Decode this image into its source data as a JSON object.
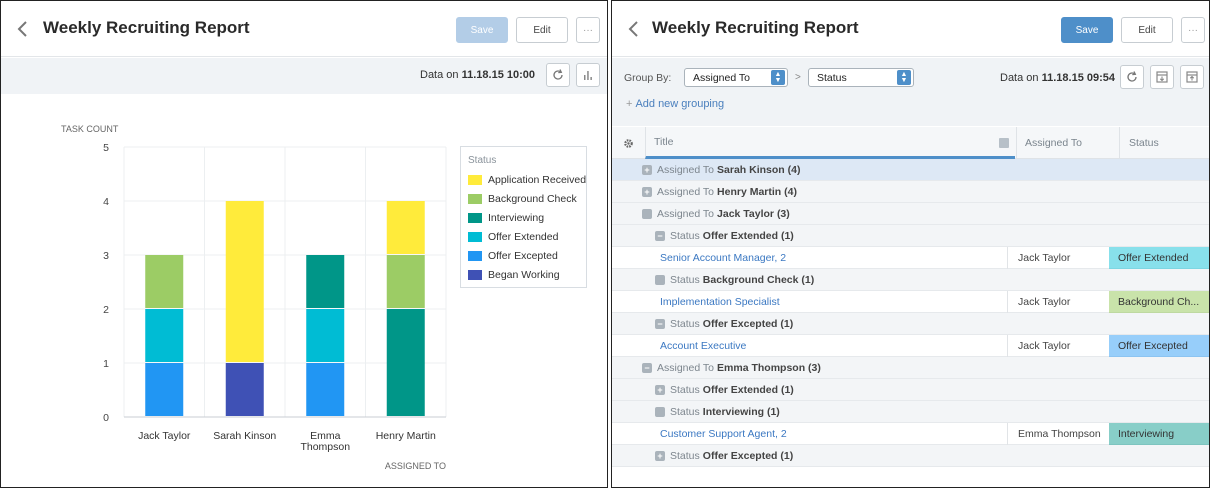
{
  "left": {
    "title": "Weekly Recruiting Report",
    "save_label": "Save",
    "edit_label": "Edit",
    "more_label": "···",
    "data_on_prefix": "Data on",
    "data_on_value": "11.18.15 10:00"
  },
  "right": {
    "title": "Weekly Recruiting Report",
    "save_label": "Save",
    "edit_label": "Edit",
    "more_label": "···",
    "data_on_prefix": "Data on",
    "data_on_value": "11.18.15 09:54",
    "group_by_label": "Group By:",
    "group_by_1": "Assigned To",
    "group_by_separator": ">",
    "group_by_2": "Status",
    "add_grouping": "Add new grouping",
    "columns": {
      "title": "Title",
      "assigned_to": "Assigned To",
      "status": "Status"
    },
    "rows": [
      {
        "kind": "group",
        "icon": "+",
        "prefix": "Assigned To",
        "value": "Sarah Kinson (4)",
        "selected": true
      },
      {
        "kind": "group",
        "icon": "+",
        "prefix": "Assigned To",
        "value": "Henry Martin (4)"
      },
      {
        "kind": "group",
        "icon": "",
        "prefix": "Assigned To",
        "value": "Jack Taylor (3)"
      },
      {
        "kind": "subgroup",
        "icon": "−",
        "prefix": "Status",
        "value": "Offer Extended (1)"
      },
      {
        "kind": "data",
        "title": "Senior Account Manager, 2",
        "assignee": "Jack Taylor",
        "status": "Offer Extended",
        "status_color": "#26c6da"
      },
      {
        "kind": "subgroup",
        "icon": "",
        "prefix": "Status",
        "value": "Background Check (1)"
      },
      {
        "kind": "data",
        "title": "Implementation Specialist",
        "assignee": "Jack Taylor",
        "status": "Background Ch...",
        "status_color": "#9ccc65"
      },
      {
        "kind": "subgroup",
        "icon": "−",
        "prefix": "Status",
        "value": "Offer Excepted (1)"
      },
      {
        "kind": "data",
        "title": "Account Executive",
        "assignee": "Jack Taylor",
        "status": "Offer Excepted",
        "status_color": "#42a5f5"
      },
      {
        "kind": "group",
        "icon": "−",
        "prefix": "Assigned To",
        "value": "Emma Thompson (3)"
      },
      {
        "kind": "subgroup",
        "icon": "+",
        "prefix": "Status",
        "value": "Offer Extended (1)"
      },
      {
        "kind": "subgroup",
        "icon": "",
        "prefix": "Status",
        "value": "Interviewing (1)"
      },
      {
        "kind": "data",
        "title": "Customer Support Agent, 2",
        "assignee": "Emma Thompson",
        "status": "Interviewing",
        "status_color": "#26a69a"
      },
      {
        "kind": "subgroup",
        "icon": "+",
        "prefix": "Status",
        "value": "Offer Excepted (1)"
      }
    ]
  },
  "colors": {
    "accent": "#4e8fc9",
    "link": "#3b78c2"
  },
  "chart_data": {
    "type": "bar",
    "stacked": true,
    "ylabel": "TASK COUNT",
    "xlabel": "ASSIGNED TO",
    "ylim": [
      0,
      5
    ],
    "yticks": [
      0,
      1,
      2,
      3,
      4,
      5
    ],
    "categories": [
      "Jack Taylor",
      "Sarah Kinson",
      "Emma Thompson",
      "Henry Martin"
    ],
    "category_lines": [
      [
        "Jack Taylor"
      ],
      [
        "Sarah Kinson"
      ],
      [
        "Emma",
        "Thompson"
      ],
      [
        "Henry Martin"
      ]
    ],
    "legend_title": "Status",
    "legend_position": "right",
    "series": [
      {
        "name": "Application Received",
        "color": "#ffeb3b",
        "values": [
          0,
          3,
          0,
          1
        ]
      },
      {
        "name": "Background Check",
        "color": "#9ccc65",
        "values": [
          1,
          0,
          0,
          1
        ]
      },
      {
        "name": "Interviewing",
        "color": "#009688",
        "values": [
          0,
          0,
          1,
          2
        ]
      },
      {
        "name": "Offer Extended",
        "color": "#00bcd4",
        "values": [
          1,
          0,
          1,
          0
        ]
      },
      {
        "name": "Offer Excepted",
        "color": "#2196f3",
        "values": [
          1,
          0,
          1,
          0
        ]
      },
      {
        "name": "Began Working",
        "color": "#3f51b5",
        "values": [
          0,
          1,
          0,
          0
        ]
      }
    ]
  }
}
